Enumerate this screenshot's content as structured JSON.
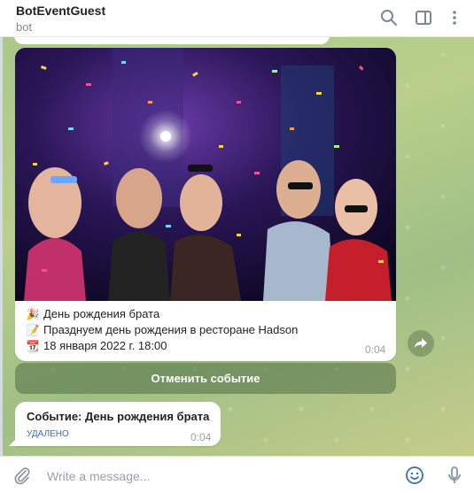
{
  "header": {
    "title": "BotEventGuest",
    "subtitle": "bot",
    "icons": [
      "search-icon",
      "sidebar-toggle-icon",
      "more-vertical-icon"
    ]
  },
  "messages": [
    {
      "type": "photo-with-caption",
      "photo_alt": "party-photo",
      "caption": [
        {
          "icon": "party-popper-icon",
          "text": "День рождения брата"
        },
        {
          "icon": "memo-pencil-icon",
          "text": "Празднуем день рождения в ресторане Hadson"
        },
        {
          "icon": "calendar-icon",
          "text": "18 января 2022 г. 18:00"
        }
      ],
      "time": "0:04"
    },
    {
      "type": "text",
      "text": "Событие: День рождения брата",
      "status": "УДАЛЕНО",
      "time": "0:04"
    }
  ],
  "inline_button": {
    "label": "Отменить событие"
  },
  "composer": {
    "placeholder": "Write a message..."
  },
  "colors": {
    "accent": "#3a6fa8",
    "chat_bg": "#aec88a"
  }
}
